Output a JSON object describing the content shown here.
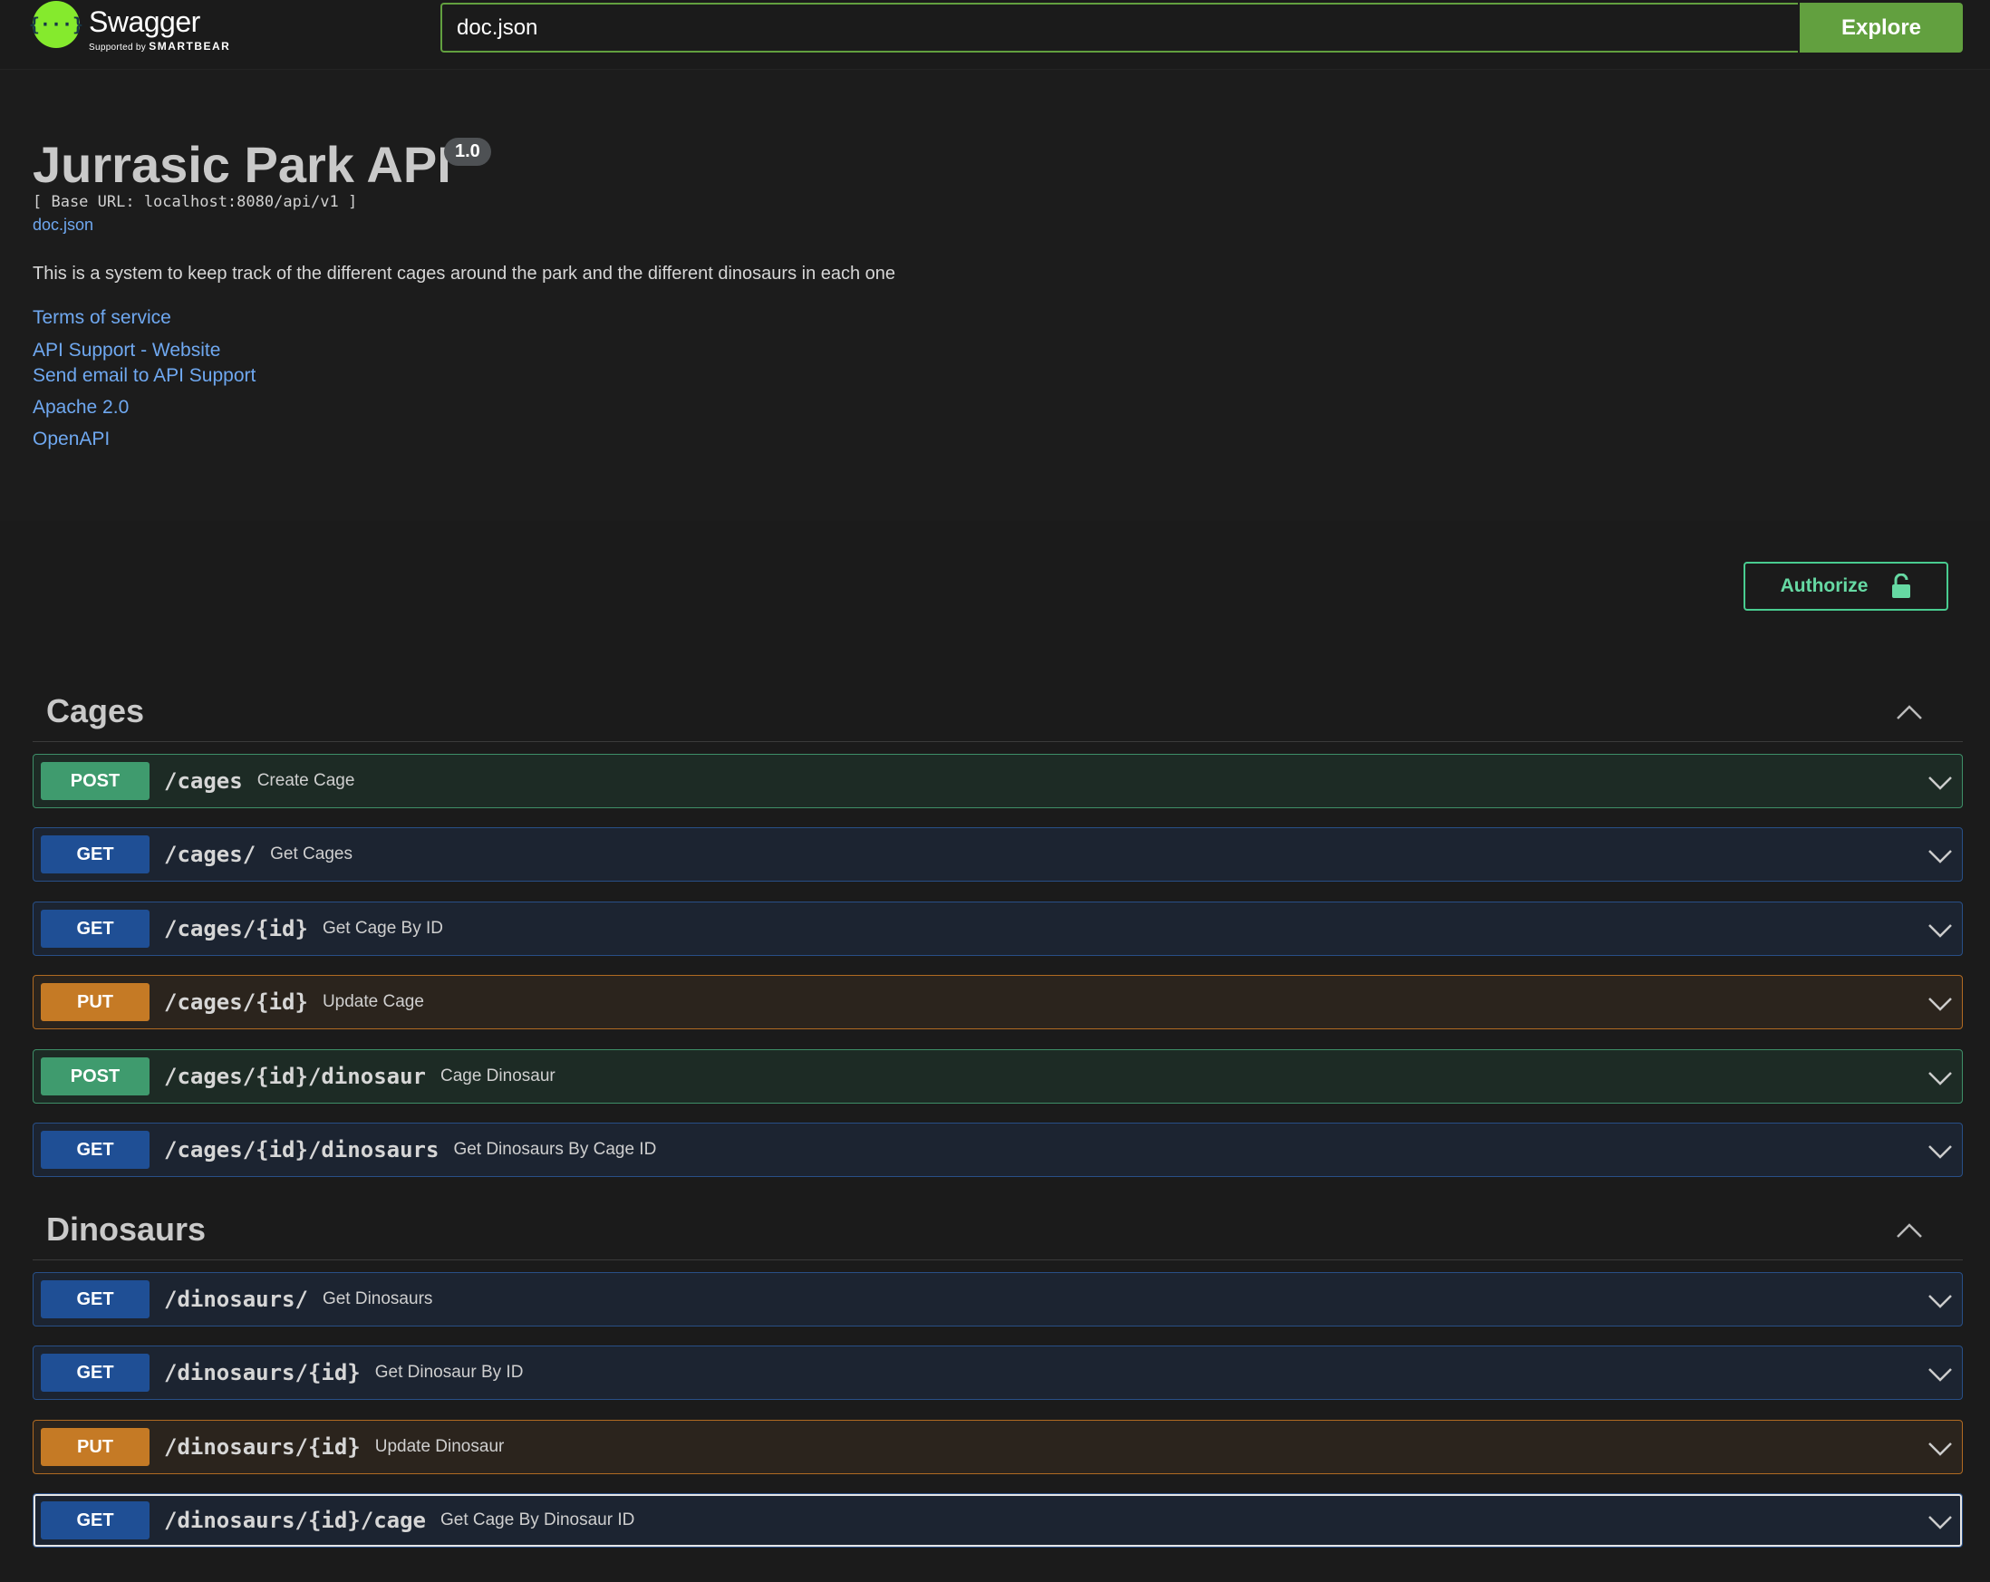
{
  "topbar": {
    "logo_name": "Swagger",
    "logo_sub_prefix": "Supported by",
    "logo_sub_brand": "SMARTBEAR",
    "url_value": "doc.json",
    "explore_label": "Explore"
  },
  "info": {
    "title": "Jurrasic Park API",
    "version": "1.0",
    "base_url": "[ Base URL: localhost:8080/api/v1 ]",
    "doc_link": "doc.json",
    "description": "This is a system to keep track of the different cages around the park and the different dinosaurs in each one",
    "links": {
      "terms": "Terms of service",
      "support_website": "API Support - Website",
      "support_email": "Send email to API Support",
      "license": "Apache 2.0",
      "openapi": "OpenAPI"
    }
  },
  "authorize_label": "Authorize",
  "colors": {
    "post": "#49cc90",
    "get": "#1f4f95",
    "put": "#c57a25",
    "accent": "#62a03f"
  },
  "sections": [
    {
      "name": "Cages",
      "operations": [
        {
          "method": "POST",
          "path": "/cages",
          "summary": "Create Cage"
        },
        {
          "method": "GET",
          "path": "/cages/",
          "summary": "Get Cages"
        },
        {
          "method": "GET",
          "path": "/cages/{id}",
          "summary": "Get Cage By ID"
        },
        {
          "method": "PUT",
          "path": "/cages/{id}",
          "summary": "Update Cage"
        },
        {
          "method": "POST",
          "path": "/cages/{id}/dinosaur",
          "summary": "Cage Dinosaur"
        },
        {
          "method": "GET",
          "path": "/cages/{id}/dinosaurs",
          "summary": "Get Dinosaurs By Cage ID"
        }
      ]
    },
    {
      "name": "Dinosaurs",
      "operations": [
        {
          "method": "GET",
          "path": "/dinosaurs/",
          "summary": "Get Dinosaurs"
        },
        {
          "method": "GET",
          "path": "/dinosaurs/{id}",
          "summary": "Get Dinosaur By ID"
        },
        {
          "method": "PUT",
          "path": "/dinosaurs/{id}",
          "summary": "Update Dinosaur"
        },
        {
          "method": "GET",
          "path": "/dinosaurs/{id}/cage",
          "summary": "Get Cage By Dinosaur ID"
        }
      ]
    }
  ]
}
